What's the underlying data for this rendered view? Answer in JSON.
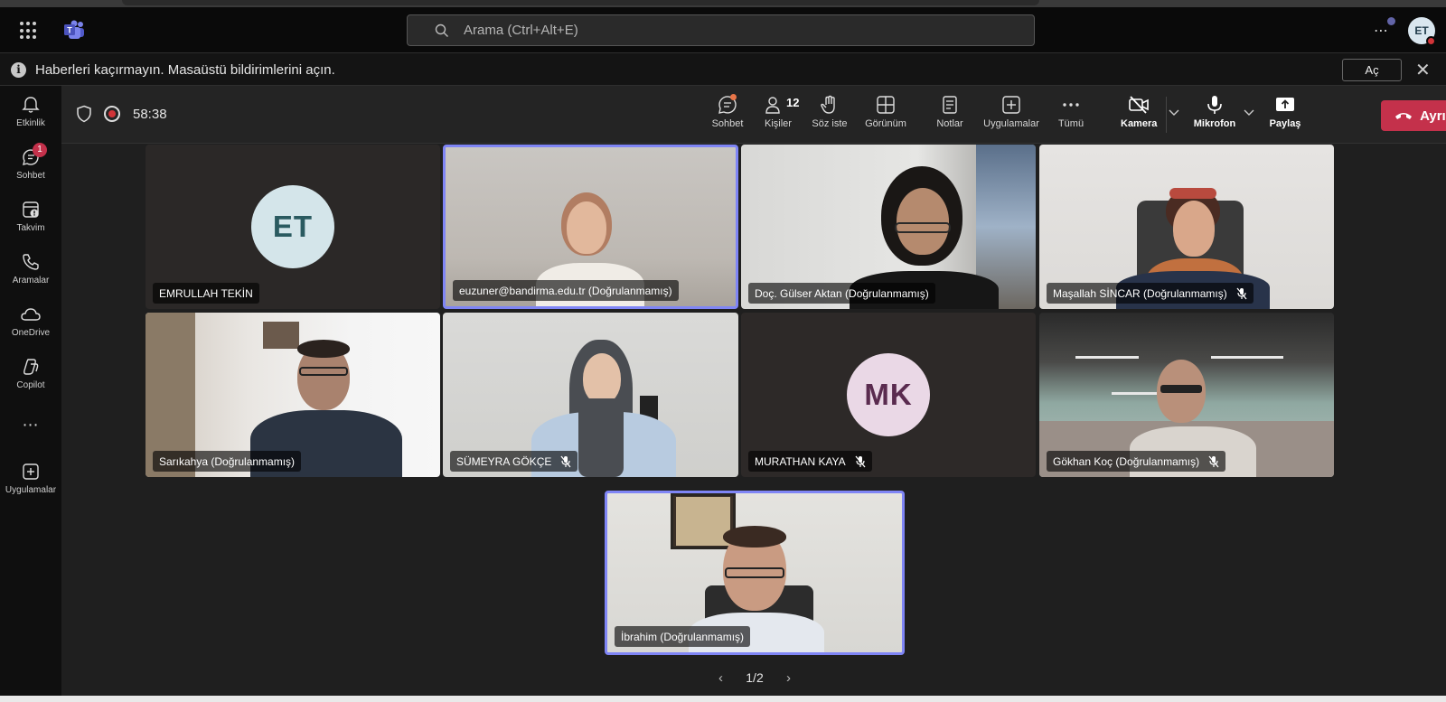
{
  "titlebar": {
    "search_placeholder": "Arama (Ctrl+Alt+E)",
    "avatar_initials": "ET",
    "more_label": "⋯"
  },
  "banner": {
    "message": "Haberleri kaçırmayın. Masaüstü bildirimlerini açın.",
    "open_label": "Aç",
    "close_label": "✕"
  },
  "rail": {
    "items": [
      {
        "label": "Etkinlik",
        "icon": "bell-icon"
      },
      {
        "label": "Sohbet",
        "icon": "chat-icon",
        "badge": "1"
      },
      {
        "label": "Takvim",
        "icon": "calendar-icon"
      },
      {
        "label": "Aramalar",
        "icon": "phone-icon"
      },
      {
        "label": "OneDrive",
        "icon": "cloud-icon"
      },
      {
        "label": "Copilot",
        "icon": "copilot-icon"
      },
      {
        "label": "Uygulamalar",
        "icon": "add-app-icon"
      }
    ],
    "more_label": "⋯"
  },
  "meeting": {
    "timer": "58:38",
    "people_count": "12",
    "tools": {
      "chat": "Sohbet",
      "people": "Kişiler",
      "raise_hand": "Söz iste",
      "view": "Görünüm",
      "notes": "Notlar",
      "apps": "Uygulamalar",
      "more": "Tümü",
      "camera": "Kamera",
      "mic": "Mikrofon",
      "share": "Paylaş"
    },
    "leave_label": "Ayrıl"
  },
  "participants": [
    {
      "name": "EMRULLAH TEKİN",
      "initials": "ET",
      "muted": false,
      "video": false,
      "avatar_bg": "#d4e5ea",
      "avatar_fg": "#2a5a60"
    },
    {
      "name": "euzuner@bandirma.edu.tr (Doğrulanmamış)",
      "muted": false,
      "video": true,
      "speaking": true
    },
    {
      "name": "Doç. Gülser Aktan (Doğrulanmamış)",
      "muted": false,
      "video": true
    },
    {
      "name": "Maşallah SİNCAR (Doğrulanmamış)",
      "muted": true,
      "video": true
    },
    {
      "name": "Sarıkahya (Doğrulanmamış)",
      "muted": false,
      "video": true
    },
    {
      "name": "SÜMEYRA GÖKÇE",
      "muted": true,
      "video": true
    },
    {
      "name": "MURATHAN KAYA",
      "initials": "MK",
      "muted": true,
      "video": false,
      "avatar_bg": "#ead8e6",
      "avatar_fg": "#5a2b4f"
    },
    {
      "name": "Gökhan Koç (Doğrulanmamış)",
      "muted": true,
      "video": true
    },
    {
      "name": "İbrahim (Doğrulanmamış)",
      "muted": false,
      "video": true,
      "speaking": true
    }
  ],
  "pager": {
    "current": "1/2",
    "prev": "‹",
    "next": "›"
  },
  "colors": {
    "accent": "#7f85f5",
    "leave": "#c4314b",
    "alert": "#d13438"
  }
}
